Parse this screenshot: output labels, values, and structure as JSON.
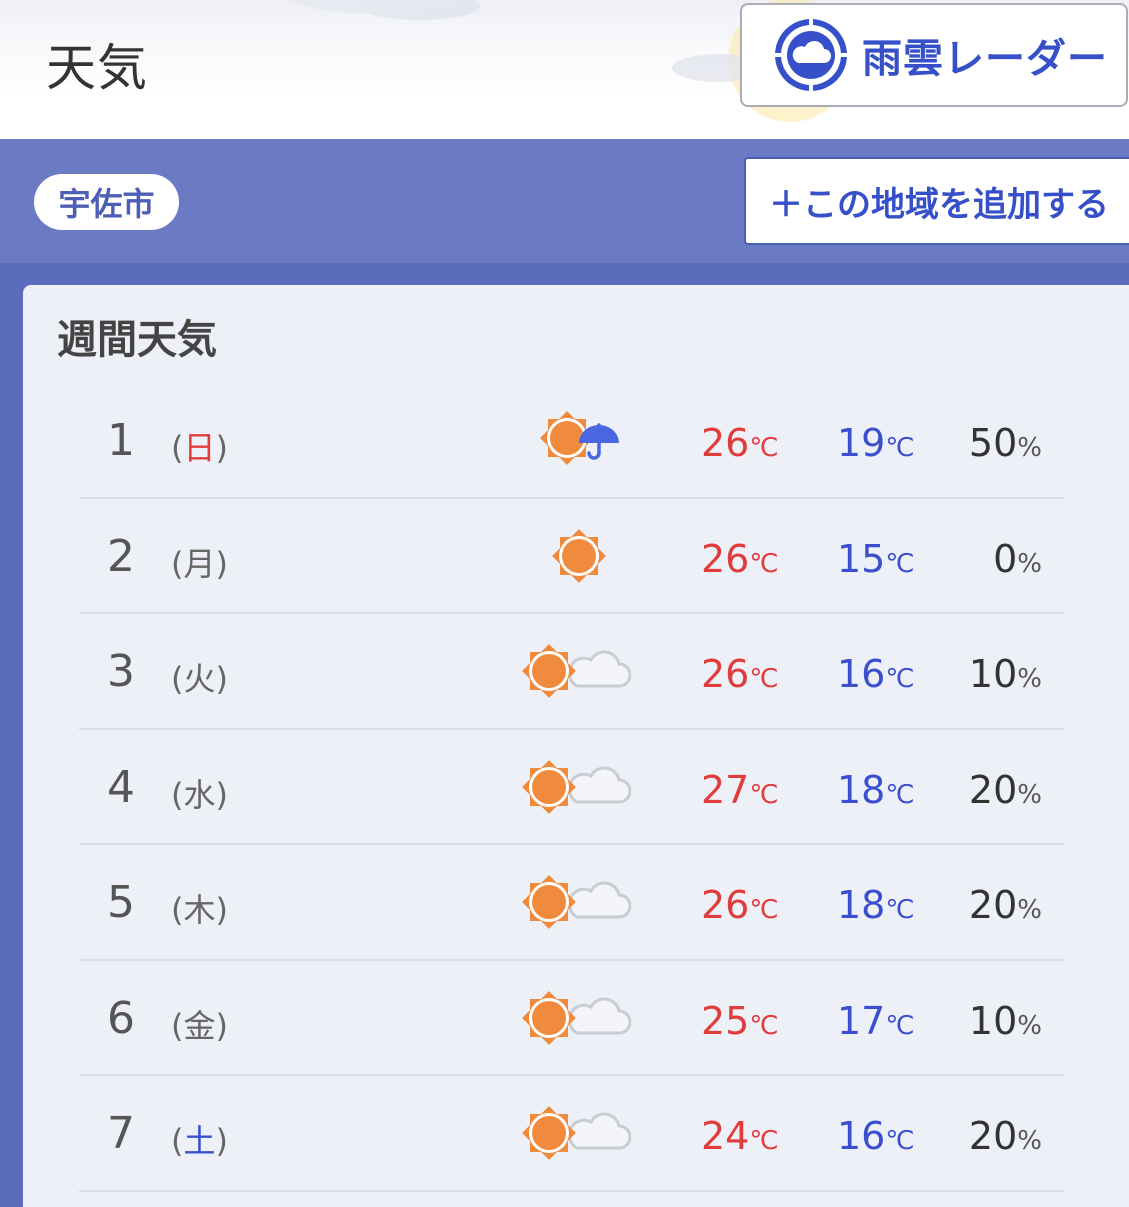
{
  "header": {
    "title": "天気",
    "radar_button": {
      "label": "雨雲レーダー"
    }
  },
  "region": {
    "city": "宇佐市",
    "add_button": "＋この地域を追加する"
  },
  "weekly": {
    "title": "週間天気",
    "temp_unit": "℃",
    "pop_unit": "%",
    "rows": [
      {
        "day": "1",
        "dow_open": "(",
        "dow": "日",
        "dow_close": ")",
        "dow_color": "#e03c3c",
        "weather": "sun-rain",
        "max": "26",
        "min": "19",
        "pop": "50"
      },
      {
        "day": "2",
        "dow_open": "(",
        "dow": "月",
        "dow_close": ")",
        "dow_color": "#666666",
        "weather": "sun",
        "max": "26",
        "min": "15",
        "pop": "0"
      },
      {
        "day": "3",
        "dow_open": "(",
        "dow": "火",
        "dow_close": ")",
        "dow_color": "#666666",
        "weather": "sun-cloud",
        "max": "26",
        "min": "16",
        "pop": "10"
      },
      {
        "day": "4",
        "dow_open": "(",
        "dow": "水",
        "dow_close": ")",
        "dow_color": "#666666",
        "weather": "sun-cloud",
        "max": "27",
        "min": "18",
        "pop": "20"
      },
      {
        "day": "5",
        "dow_open": "(",
        "dow": "木",
        "dow_close": ")",
        "dow_color": "#666666",
        "weather": "sun-cloud",
        "max": "26",
        "min": "18",
        "pop": "20"
      },
      {
        "day": "6",
        "dow_open": "(",
        "dow": "金",
        "dow_close": ")",
        "dow_color": "#666666",
        "weather": "sun-cloud",
        "max": "25",
        "min": "17",
        "pop": "10"
      },
      {
        "day": "7",
        "dow_open": "(",
        "dow": "土",
        "dow_close": ")",
        "dow_color": "#3a4fcf",
        "weather": "sun-cloud",
        "max": "24",
        "min": "16",
        "pop": "20"
      }
    ]
  },
  "colors": {
    "accent": "#3550c8",
    "region_band": "#6a7bc4",
    "week_bg": "#5a6cbc",
    "temp_max": "#e03c3c",
    "temp_min": "#3a4fcf",
    "sun": "#f08a3c"
  }
}
